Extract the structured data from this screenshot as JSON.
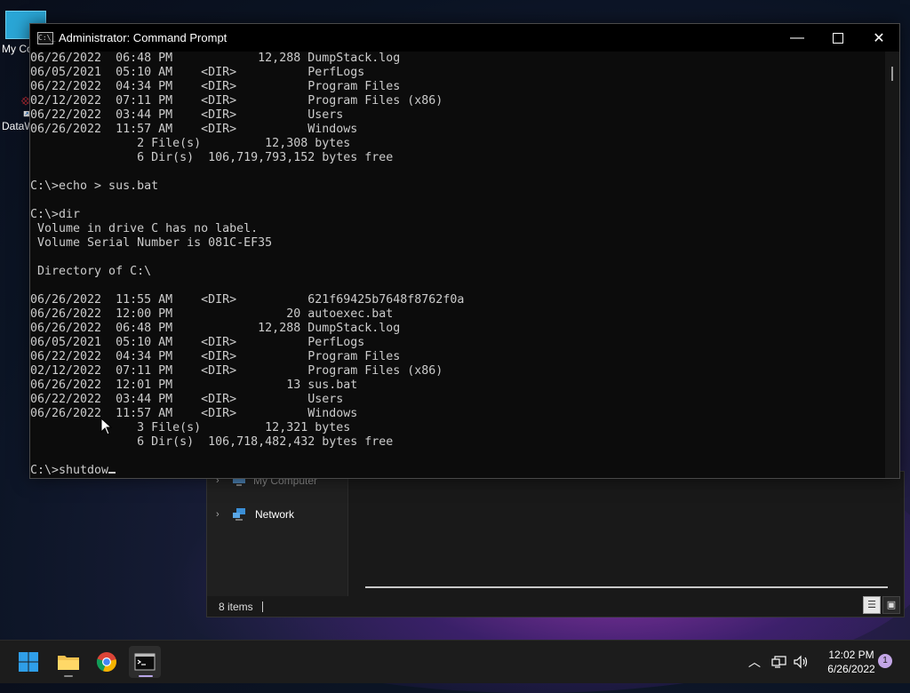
{
  "desktop": {
    "icons": [
      {
        "label": "My Co"
      },
      {
        "label": "DataW"
      }
    ]
  },
  "explorer": {
    "nav_items": [
      {
        "label": "My Computer"
      },
      {
        "label": "Network"
      }
    ],
    "status": {
      "items_count": "8 items"
    }
  },
  "cmd": {
    "title": "Administrator: Command Prompt",
    "lines": [
      "06/26/2022  06:48 PM            12,288 DumpStack.log",
      "06/05/2021  05:10 AM    <DIR>          PerfLogs",
      "06/22/2022  04:34 PM    <DIR>          Program Files",
      "02/12/2022  07:11 PM    <DIR>          Program Files (x86)",
      "06/22/2022  03:44 PM    <DIR>          Users",
      "06/26/2022  11:57 AM    <DIR>          Windows",
      "               2 File(s)         12,308 bytes",
      "               6 Dir(s)  106,719,793,152 bytes free",
      "",
      "C:\\>echo > sus.bat",
      "",
      "C:\\>dir",
      " Volume in drive C has no label.",
      " Volume Serial Number is 081C-EF35",
      "",
      " Directory of C:\\",
      "",
      "06/26/2022  11:55 AM    <DIR>          621f69425b7648f8762f0a",
      "06/26/2022  12:00 PM                20 autoexec.bat",
      "06/26/2022  06:48 PM            12,288 DumpStack.log",
      "06/05/2021  05:10 AM    <DIR>          PerfLogs",
      "06/22/2022  04:34 PM    <DIR>          Program Files",
      "02/12/2022  07:11 PM    <DIR>          Program Files (x86)",
      "06/26/2022  12:01 PM                13 sus.bat",
      "06/22/2022  03:44 PM    <DIR>          Users",
      "06/26/2022  11:57 AM    <DIR>          Windows",
      "               3 File(s)         12,321 bytes",
      "               6 Dir(s)  106,718,482,432 bytes free",
      "",
      "C:\\>shutdow"
    ]
  },
  "taskbar": {
    "apps": [
      {
        "name": "start"
      },
      {
        "name": "file-explorer"
      },
      {
        "name": "chrome"
      },
      {
        "name": "command-prompt"
      }
    ],
    "clock": {
      "time": "12:02 PM",
      "date": "6/26/2022"
    },
    "notification_count": "1"
  }
}
